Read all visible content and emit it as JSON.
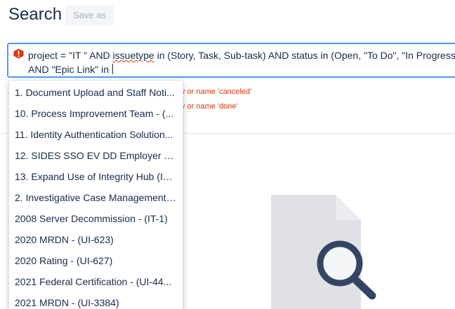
{
  "header": {
    "title": "Search",
    "save_as_label": "Save as"
  },
  "query": {
    "line1_a": "project = \"IT \" AND ",
    "line1_underlined": "issuetype",
    "line1_b": " in (Story, Task, Sub-task) AND status in (Open, \"To Do\", \"In Progress\")",
    "line2": "AND \"Epic Link\" in ",
    "error_icon": "error-icon"
  },
  "errors": [
    "y or name 'canceled'",
    "y or name 'done'"
  ],
  "suggestions": [
    "1. Document Upload and Staff Noti...",
    "10. Process Improvement Team - (...",
    "11. Identity Authentication Solution...",
    "12. SIDES SSO EV DD Employer Ou...",
    "13. Expand Use of Integrity Hub (ID...",
    "2. Investigative Case Management ...",
    "2008 Server Decommission - (IT-1)",
    "2020 MRDN - (UI-623)",
    "2020 Rating - (UI-627)",
    "2021 Federal Certification - (UI-44...",
    "2021 MRDN - (UI-3384)"
  ],
  "empty_state": {
    "icon": "no-results-document-search-icon"
  },
  "colors": {
    "focus_border": "#4c9aff",
    "error": "#de350b",
    "text": "#172b4d"
  }
}
